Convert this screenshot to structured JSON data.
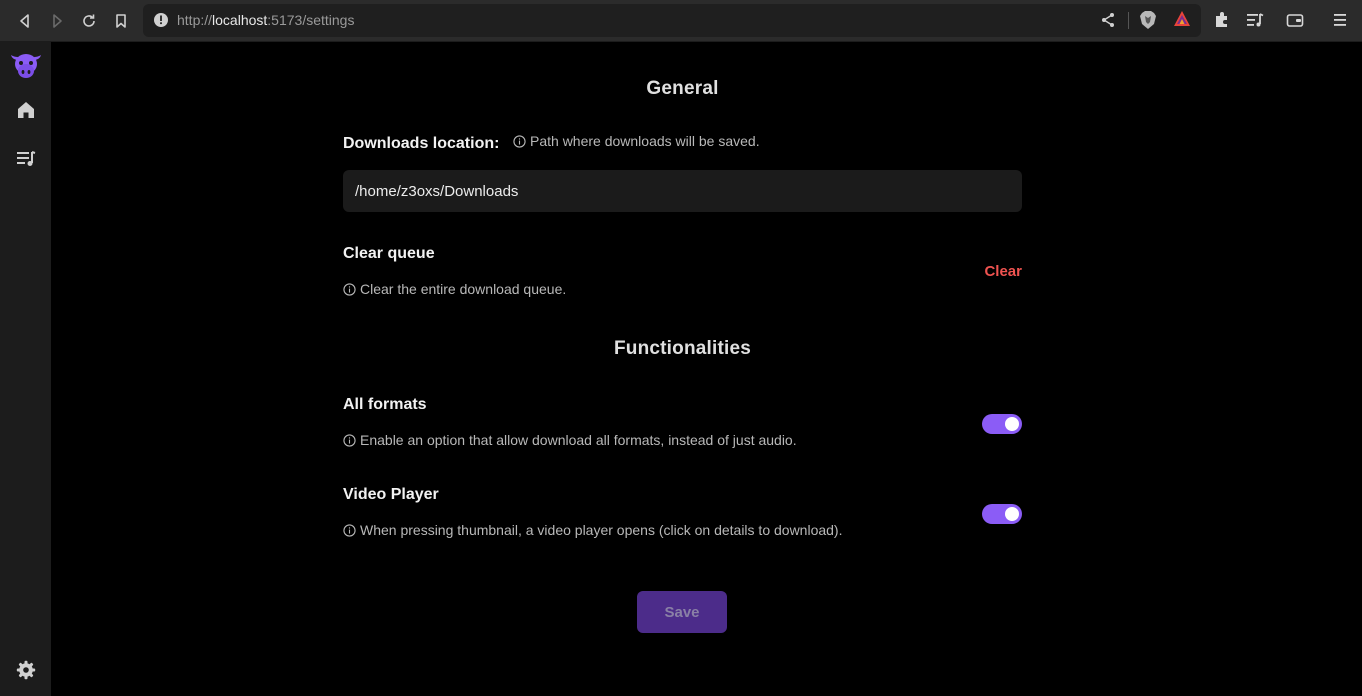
{
  "browser": {
    "url_scheme": "http://",
    "url_host": "localhost",
    "url_path": ":5173/settings",
    "icons": [
      "back-icon",
      "forward-icon",
      "reload-icon",
      "bookmark-icon",
      "site-info-icon",
      "share-icon",
      "brave-shields-icon",
      "brave-rewards-icon",
      "extensions-icon",
      "media-playlist-icon",
      "wallet-icon",
      "menu-icon"
    ]
  },
  "sidebar": {
    "items": [
      {
        "name": "logo",
        "icon": "cow-logo-icon"
      },
      {
        "name": "home",
        "icon": "home-icon"
      },
      {
        "name": "queue",
        "icon": "playlist-music-icon"
      },
      {
        "name": "settings",
        "icon": "gear-icon"
      }
    ]
  },
  "general": {
    "title": "General",
    "downloads_label": "Downloads location:",
    "downloads_hint": "Path where downloads will be saved.",
    "downloads_value": "/home/z3oxs/Downloads",
    "clear_label": "Clear queue",
    "clear_hint": "Clear the entire download queue.",
    "clear_button": "Clear"
  },
  "functionalities": {
    "title": "Functionalities",
    "all_formats_label": "All formats",
    "all_formats_hint": "Enable an option that allow download all formats, instead of just audio.",
    "all_formats_enabled": true,
    "video_player_label": "Video Player",
    "video_player_hint": "When pressing thumbnail, a video player opens (click on details to download).",
    "video_player_enabled": true
  },
  "save_button": "Save",
  "colors": {
    "accent": "#8b5cf6",
    "danger": "#ef5350",
    "save_bg": "#4c2c8a"
  }
}
